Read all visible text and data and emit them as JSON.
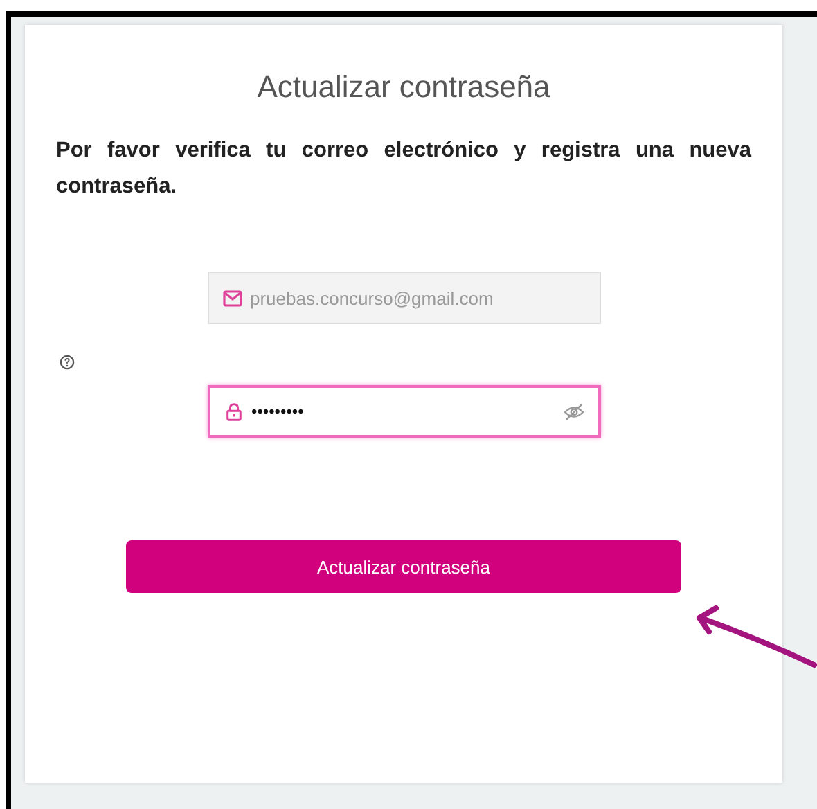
{
  "dialog": {
    "title": "Actualizar contraseña",
    "instructions": "Por favor verifica tu correo electrónico y registra una nueva contraseña.",
    "email_field": {
      "value": "pruebas.concurso@gmail.com",
      "disabled": true
    },
    "password_field": {
      "value": "•••••••••",
      "focused": true
    },
    "submit_button": {
      "label": "Actualizar contraseña"
    }
  }
}
